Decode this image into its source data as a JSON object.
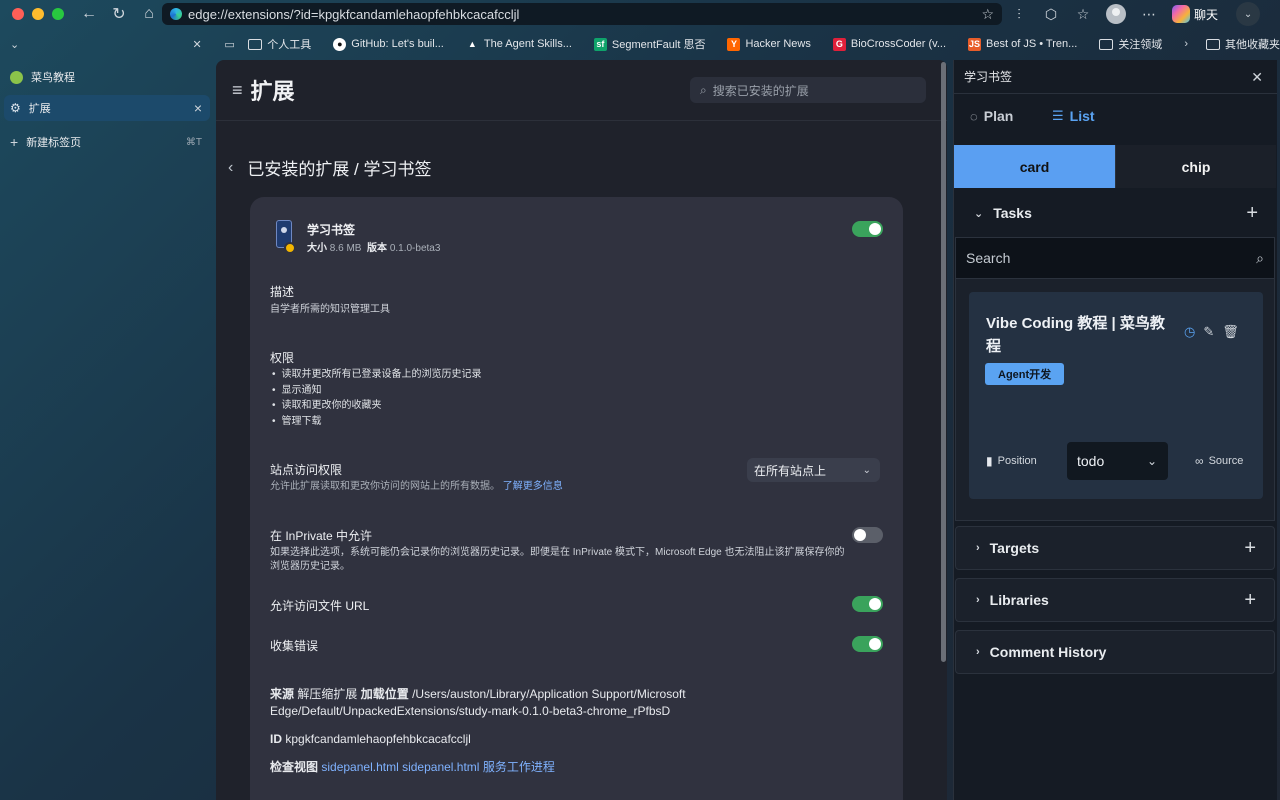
{
  "browser": {
    "url": "edge://extensions/?id=kpgkfcandamlehaopfehbkcacafccljl",
    "chat_label": "聊天"
  },
  "bookmarks": [
    {
      "label": "个人工具",
      "icon": "folder-icon",
      "color": ""
    },
    {
      "label": "GitHub: Let's buil...",
      "icon": "github-icon",
      "color": "#ffffff"
    },
    {
      "label": "The Agent Skills...",
      "icon": "triangle-icon",
      "color": "#ffffff"
    },
    {
      "label": "SegmentFault 思否",
      "icon": "sf-icon",
      "color": "#0fa36b"
    },
    {
      "label": "Hacker News",
      "icon": "y-icon",
      "color": "#ff6600"
    },
    {
      "label": "BioCrossCoder (v...",
      "icon": "g-icon",
      "color": "#e0203a"
    },
    {
      "label": "Best of JS • Tren...",
      "icon": "js-icon",
      "color": "#e85d2a"
    },
    {
      "label": "关注领域",
      "icon": "folder-icon",
      "color": ""
    }
  ],
  "bookmarks_other": "其他收藏夹",
  "tabs": [
    {
      "label": "菜鸟教程",
      "active": false
    },
    {
      "label": "扩展",
      "active": true
    }
  ],
  "new_tab": {
    "label": "新建标签页",
    "shortcut": "⌘T"
  },
  "ext_page": {
    "title": "扩展",
    "search_placeholder": "搜索已安装的扩展",
    "breadcrumb": "已安装的扩展 / 学习书签",
    "name": "学习书签",
    "size_label": "大小",
    "size": "8.6 MB",
    "version_label": "版本",
    "version": "0.1.0-beta3",
    "desc_title": "描述",
    "desc_text": "自学者所需的知识管理工具",
    "perm_title": "权限",
    "permissions": [
      "读取并更改所有已登录设备上的浏览历史记录",
      "显示通知",
      "读取和更改你的收藏夹",
      "管理下载"
    ],
    "site_title": "站点访问权限",
    "site_text": "允许此扩展读取和更改你访问的网站上的所有数据。",
    "site_link": "了解更多信息",
    "site_select": "在所有站点上",
    "inprivate_title": "在 InPrivate 中允许",
    "inprivate_text": "如果选择此选项，系统可能仍会记录你的浏览器历史记录。即便是在 InPrivate 模式下，Microsoft Edge 也无法阻止该扩展保存你的浏览器历史记录。",
    "file_url_title": "允许访问文件 URL",
    "errors_title": "收集错误",
    "source_label": "来源",
    "source_value": "解压缩扩展",
    "load_label": "加载位置",
    "load_path": "/Users/auston/Library/Application Support/Microsoft Edge/Default/UnpackedExtensions/study-mark-0.1.0-beta3-chrome_rPfbsD",
    "id_label": "ID",
    "id_value": "kpgkfcandamlehaopfehbkcacafccljl",
    "inspect_label": "检查视图",
    "inspect_links": [
      "sidepanel.html",
      "sidepanel.html",
      "服务工作进程"
    ],
    "toggles": {
      "enabled": true,
      "inprivate": false,
      "file_url": true,
      "errors": true
    }
  },
  "panel": {
    "title": "学习书签",
    "plan_label": "Plan",
    "list_label": "List",
    "card_label": "card",
    "chip_label": "chip",
    "tasks_label": "Tasks",
    "search_placeholder": "Search",
    "task": {
      "title": "Vibe Coding 教程 | 菜鸟教程",
      "tag": "Agent开发",
      "position_label": "Position",
      "status": "todo",
      "source_label": "Source"
    },
    "targets_label": "Targets",
    "libraries_label": "Libraries",
    "comment_label": "Comment History"
  },
  "colors": {
    "accent": "#5a9ff2",
    "toggle_on": "#3aa35c",
    "active_tab": "#1c4a6b"
  }
}
